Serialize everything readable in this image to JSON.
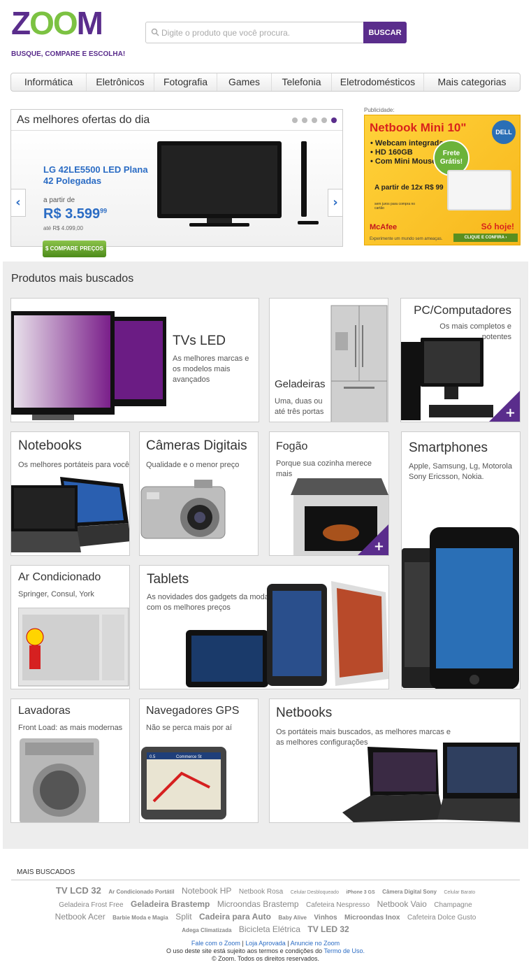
{
  "logo": {
    "word_z": "Z",
    "word_oo": "OO",
    "word_m": "M",
    "tagline": "BUSQUE, COMPARE E ESCOLHA!"
  },
  "search": {
    "placeholder": "Digite o produto que você procura.",
    "button": "BUSCAR"
  },
  "nav": [
    "Informática",
    "Eletrônicos",
    "Fotografia",
    "Games",
    "Telefonia",
    "Eletrodomésticos",
    "Mais categorias"
  ],
  "offers": {
    "title": "As melhores ofertas do dia",
    "dot_count": 5,
    "active_dot": 5,
    "product": "LG 42LE5500 LED Plana 42 Polegadas",
    "from_label": "a partir de",
    "price": "R$ 3.599",
    "price_cents": "99",
    "old_price": "até R$ 4.099,00",
    "compare_button": "COMPARE PREÇOS"
  },
  "ad": {
    "label": "Publicidade:",
    "title": "Netbook Mini 10\"",
    "brand": "DELL",
    "features": [
      "• Webcam integrada",
      "• HD 160GB",
      "• Com Mini Mouse"
    ],
    "frete": "Frete Grátis!",
    "parcel": "A partir de 12x R$ 99",
    "parcel_note": "sem juros para compra no cartão",
    "sponsor": "McAfee",
    "sponsor_tag": "Experimente um mundo sem ameaças.",
    "sohoje": "Só hoje!",
    "cta": "CLIQUE E CONFIRA ›"
  },
  "section_title": "Produtos mais buscados",
  "cards": {
    "tvs": {
      "title": "TVs LED",
      "desc": "As melhores marcas e os modelos mais avançados"
    },
    "geladeiras": {
      "title": "Geladeiras",
      "desc": "Uma, duas ou até três portas"
    },
    "pc": {
      "title": "PC/Computadores",
      "desc": "Os mais completos e potentes"
    },
    "notebooks": {
      "title": "Notebooks",
      "desc": "Os melhores portáteis para você"
    },
    "cameras": {
      "title": "Câmeras Digitais",
      "desc": "Qualidade e o menor preço"
    },
    "fogao": {
      "title": "Fogão",
      "desc": "Porque sua cozinha merece mais"
    },
    "smartphones": {
      "title": "Smartphones",
      "desc": "Apple, Samsung, Lg, Motorola Sony Ericsson, Nokia."
    },
    "ar": {
      "title": "Ar Condicionado",
      "desc": "Springer, Consul, York"
    },
    "tablets": {
      "title": "Tablets",
      "desc": "As novidades dos gadgets da moda com os melhores preços"
    },
    "lavadoras": {
      "title": "Lavadoras",
      "desc": "Front Load: as mais modernas"
    },
    "gps": {
      "title": "Navegadores GPS",
      "desc": "Não se perca mais por aí"
    },
    "netbooks": {
      "title": "Netbooks",
      "desc": "Os portáteis mais buscados, as melhores marcas e as melhores configurações"
    }
  },
  "gps_screen": {
    "street": "Commerce St",
    "distance": "0.5"
  },
  "mais_buscados": {
    "label": "MAIS BUSCADOS",
    "tags": [
      {
        "t": "TV LCD 32",
        "s": 13,
        "b": true
      },
      {
        "t": "Ar Condicionado Portátil",
        "s": 8,
        "b": true
      },
      {
        "t": "Notebook HP",
        "s": 12,
        "b": false
      },
      {
        "t": "Netbook Rosa",
        "s": 10,
        "b": false
      },
      {
        "t": "Celular Desbloqueado",
        "s": 7,
        "b": false
      },
      {
        "t": "iPhone 3 GS",
        "s": 7,
        "b": true
      },
      {
        "t": "Câmera Digital Sony",
        "s": 8,
        "b": true
      },
      {
        "t": "Celular Barato",
        "s": 7,
        "b": false
      },
      {
        "t": "Geladeira Frost Free",
        "s": 10,
        "b": false
      },
      {
        "t": "Geladeira Brastemp",
        "s": 12,
        "b": true
      },
      {
        "t": "Microondas Brastemp",
        "s": 12,
        "b": false
      },
      {
        "t": "Cafeteira Nespresso",
        "s": 10,
        "b": false
      },
      {
        "t": "Netbook Vaio",
        "s": 12,
        "b": false
      },
      {
        "t": "Champagne",
        "s": 10,
        "b": false
      },
      {
        "t": "Netbook Acer",
        "s": 12,
        "b": false
      },
      {
        "t": "Barbie Moda e Magia",
        "s": 8,
        "b": true
      },
      {
        "t": "Split",
        "s": 12,
        "b": false
      },
      {
        "t": "Cadeira para Auto",
        "s": 12,
        "b": true
      },
      {
        "t": "Baby Alive",
        "s": 8,
        "b": true
      },
      {
        "t": "Vinhos",
        "s": 10,
        "b": true
      },
      {
        "t": "Microondas Inox",
        "s": 10,
        "b": true
      },
      {
        "t": "Cafeteira Dolce Gusto",
        "s": 10,
        "b": false
      },
      {
        "t": "Adega Climatizada",
        "s": 8,
        "b": true
      },
      {
        "t": "Bicicleta Elétrica",
        "s": 12,
        "b": false
      },
      {
        "t": "TV LED 32",
        "s": 12,
        "b": true
      }
    ]
  },
  "footer": {
    "links": [
      "Fale com o Zoom",
      "Loja Aprovada",
      "Anuncie no Zoom"
    ],
    "terms_prefix": "O uso deste site está sujeito aos termos e condições do",
    "terms_link": "Termo de Uso.",
    "copyright": "© Zoom. Todos os direitos reservados."
  },
  "colors": {
    "brand": "#5a2d8c",
    "accent": "#7cc242",
    "link": "#2b6cc4"
  }
}
